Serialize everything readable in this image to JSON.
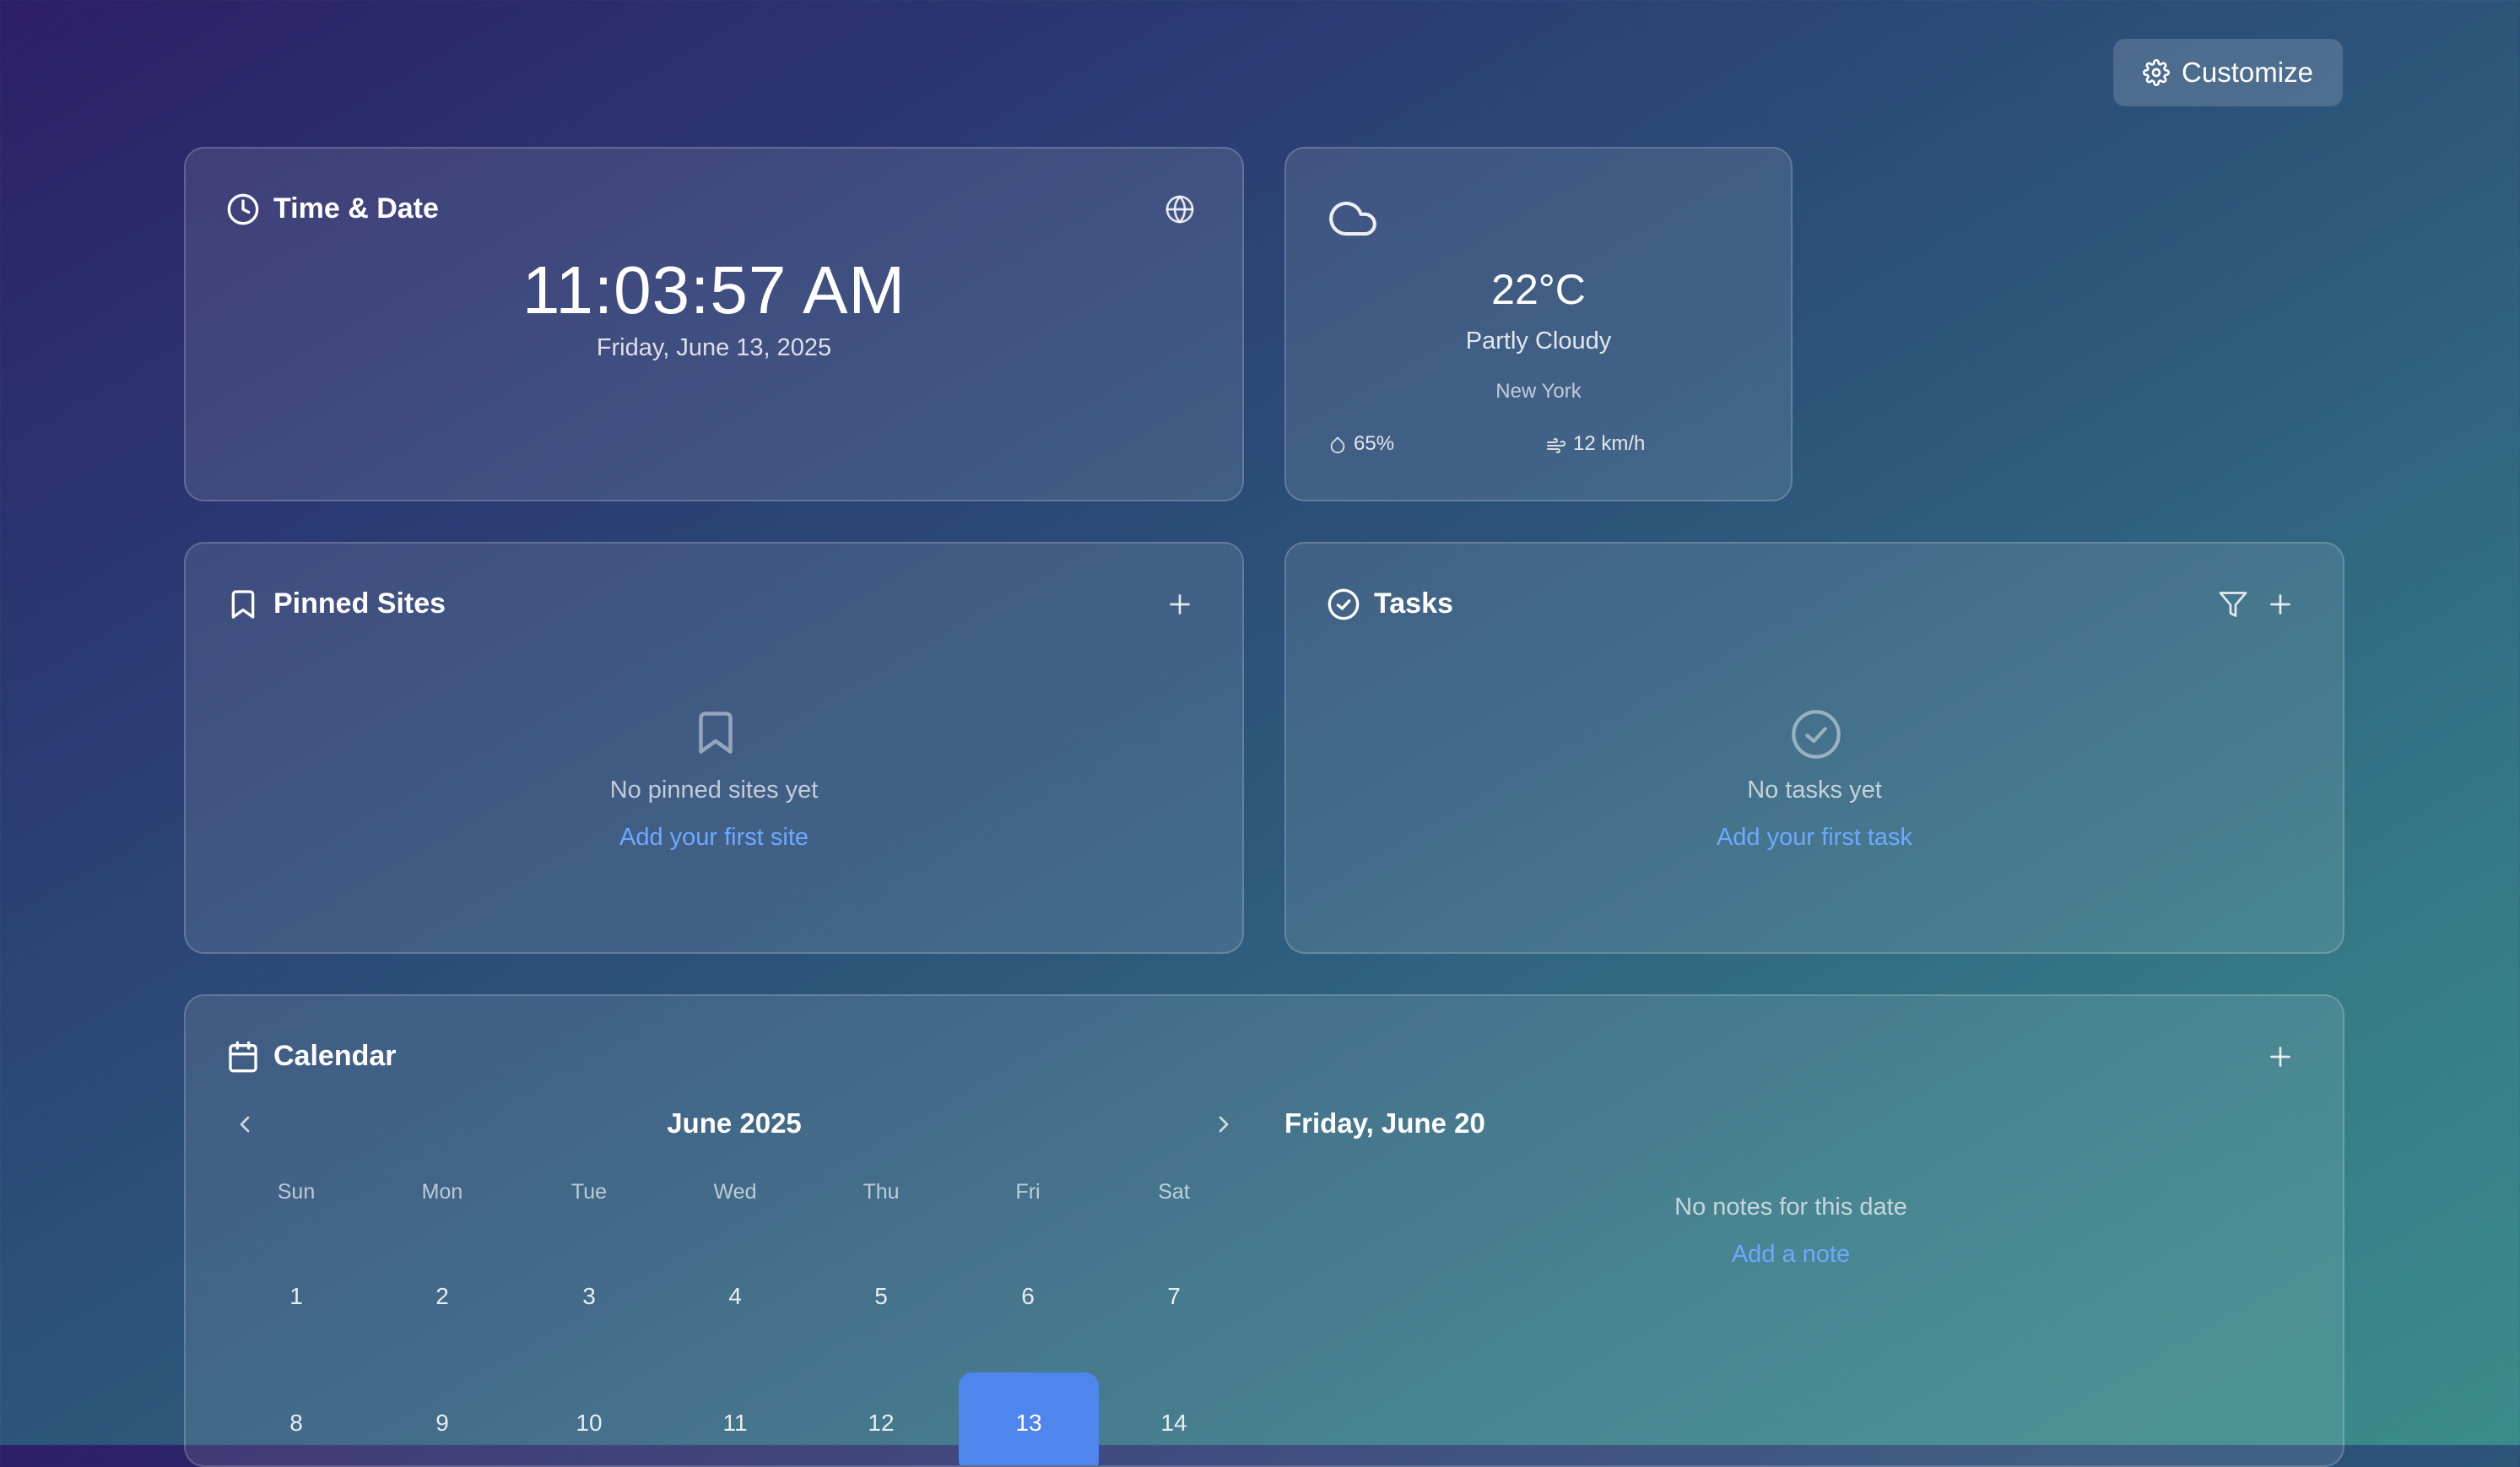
{
  "header": {
    "customize_label": "Customize"
  },
  "time_card": {
    "title": "Time & Date",
    "time": "11:03:57 AM",
    "date": "Friday, June 13, 2025"
  },
  "weather_card": {
    "temperature": "22°C",
    "condition": "Partly Cloudy",
    "location": "New York",
    "humidity": "65%",
    "wind": "12 km/h"
  },
  "pinned_sites": {
    "title": "Pinned Sites",
    "empty_text": "No pinned sites yet",
    "add_link": "Add your first site"
  },
  "tasks": {
    "title": "Tasks",
    "empty_text": "No tasks yet",
    "add_link": "Add your first task"
  },
  "calendar": {
    "title": "Calendar",
    "month_label": "June 2025",
    "weekdays": [
      "Sun",
      "Mon",
      "Tue",
      "Wed",
      "Thu",
      "Fri",
      "Sat"
    ],
    "weeks": [
      [
        "1",
        "2",
        "3",
        "4",
        "5",
        "6",
        "7"
      ],
      [
        "8",
        "9",
        "10",
        "11",
        "12",
        "13",
        "14"
      ]
    ],
    "selected_day": "13",
    "notes_date": "Friday, June 20",
    "notes_empty": "No notes for this date",
    "add_note": "Add a note"
  },
  "colors": {
    "accent": "#4f86ee",
    "link": "#6ea8ff"
  }
}
